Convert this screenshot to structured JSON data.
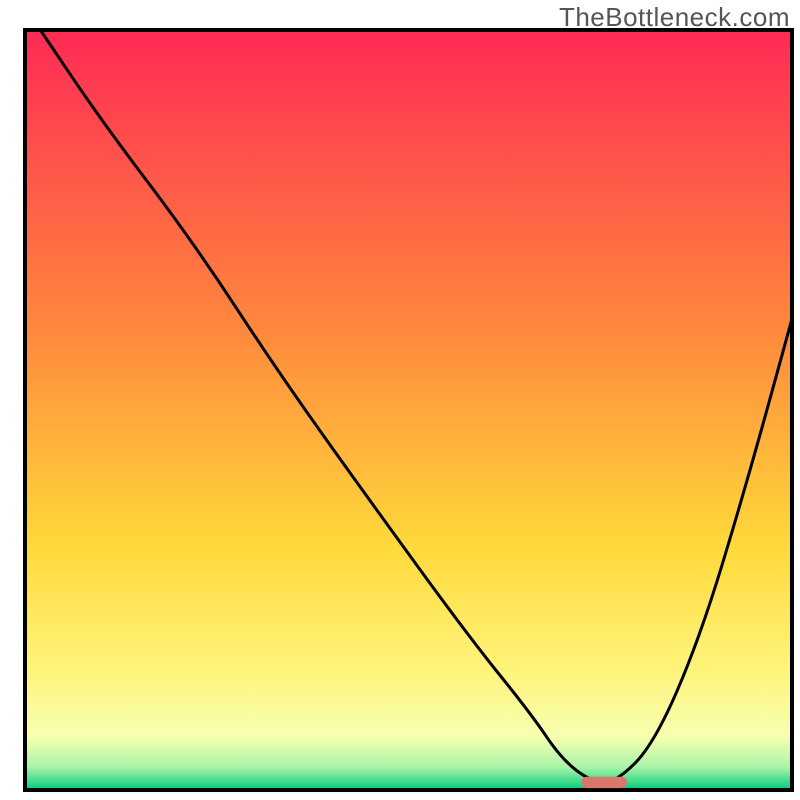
{
  "watermark": "TheBottleneck.com",
  "chart_data": {
    "type": "line",
    "title": "",
    "xlabel": "",
    "ylabel": "",
    "xlim": [
      0,
      100
    ],
    "ylim": [
      0,
      100
    ],
    "axes_visible": false,
    "grid": false,
    "background": {
      "type": "vertical_gradient",
      "stops": [
        {
          "offset": 0,
          "color": "#ff2a55"
        },
        {
          "offset": 40,
          "color": "#ff8a3c"
        },
        {
          "offset": 68,
          "color": "#ffd93b"
        },
        {
          "offset": 84,
          "color": "#fff47a"
        },
        {
          "offset": 93,
          "color": "#f7ffb0"
        },
        {
          "offset": 97,
          "color": "#a8f5a8"
        },
        {
          "offset": 100,
          "color": "#00c97b"
        }
      ]
    },
    "frame_color": "#000000",
    "series": [
      {
        "name": "bottleneck-curve",
        "color": "#000000",
        "width": 2,
        "x": [
          2,
          10,
          22,
          33,
          45,
          58,
          66,
          70,
          74,
          77,
          82,
          88,
          94,
          100
        ],
        "values": [
          100,
          88,
          72,
          55,
          38,
          20,
          10,
          4,
          1,
          1,
          6,
          20,
          40,
          62
        ]
      }
    ],
    "marker": {
      "name": "optimal-point-marker",
      "x": 75.5,
      "y": 1,
      "width": 6,
      "height": 1.5,
      "color": "#d9776a",
      "shape": "pill"
    }
  }
}
